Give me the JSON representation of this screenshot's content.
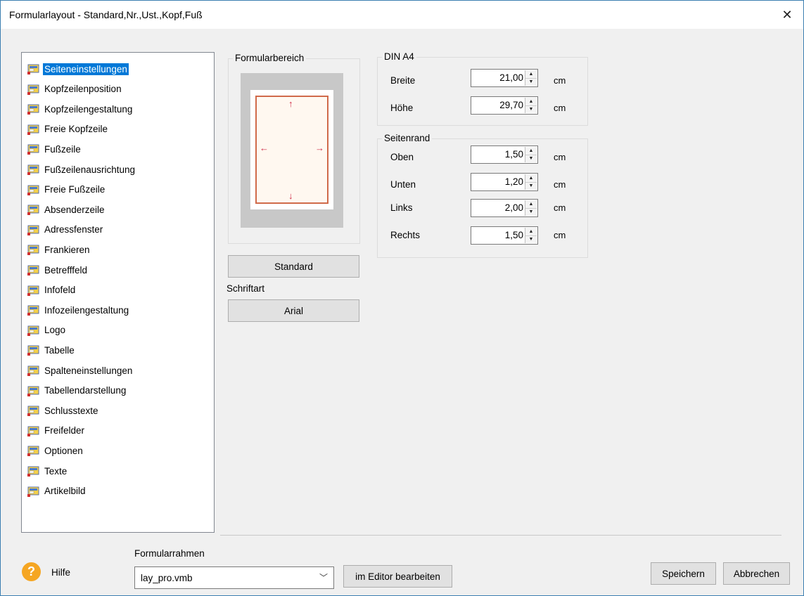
{
  "window": {
    "title": "Formularlayout - Standard,Nr.,Ust.,Kopf,Fuß"
  },
  "tree": {
    "items": [
      "Seiteneinstellungen",
      "Kopfzeilenposition",
      "Kopfzeilengestaltung",
      "Freie Kopfzeile",
      "Fußzeile",
      "Fußzeilenausrichtung",
      "Freie Fußzeile",
      "Absenderzeile",
      "Adressfenster",
      "Frankieren",
      "Betrefffeld",
      "Infofeld",
      "Infozeilengestaltung",
      "Logo",
      "Tabelle",
      "Spalteneinstellungen",
      "Tabellendarstellung",
      "Schlusstexte",
      "Freifelder",
      "Optionen",
      "Texte",
      "Artikelbild"
    ],
    "selected": "Seiteneinstellungen"
  },
  "formularbereich": {
    "title": "Formularbereich"
  },
  "buttons": {
    "standard": "Standard",
    "font": "Arial",
    "edit": "im Editor bearbeiten",
    "save": "Speichern",
    "cancel": "Abbrechen"
  },
  "schriftart_label": "Schriftart",
  "din": {
    "title": "DIN A4",
    "fields": [
      {
        "label": "Breite",
        "value": "21,00",
        "unit": "cm"
      },
      {
        "label": "Höhe",
        "value": "29,70",
        "unit": "cm"
      }
    ]
  },
  "margins": {
    "title": "Seitenrand",
    "fields": [
      {
        "label": "Oben",
        "value": "1,50",
        "unit": "cm"
      },
      {
        "label": "Unten",
        "value": "1,20",
        "unit": "cm"
      },
      {
        "label": "Links",
        "value": "2,00",
        "unit": "cm"
      },
      {
        "label": "Rechts",
        "value": "1,50",
        "unit": "cm"
      }
    ]
  },
  "footer": {
    "help": "Hilfe",
    "frame_label": "Formularrahmen",
    "frame_value": "lay_pro.vmb"
  },
  "colors": {
    "selection": "#0078d7",
    "help_icon": "#f5a623",
    "arrow": "#d0304a"
  }
}
